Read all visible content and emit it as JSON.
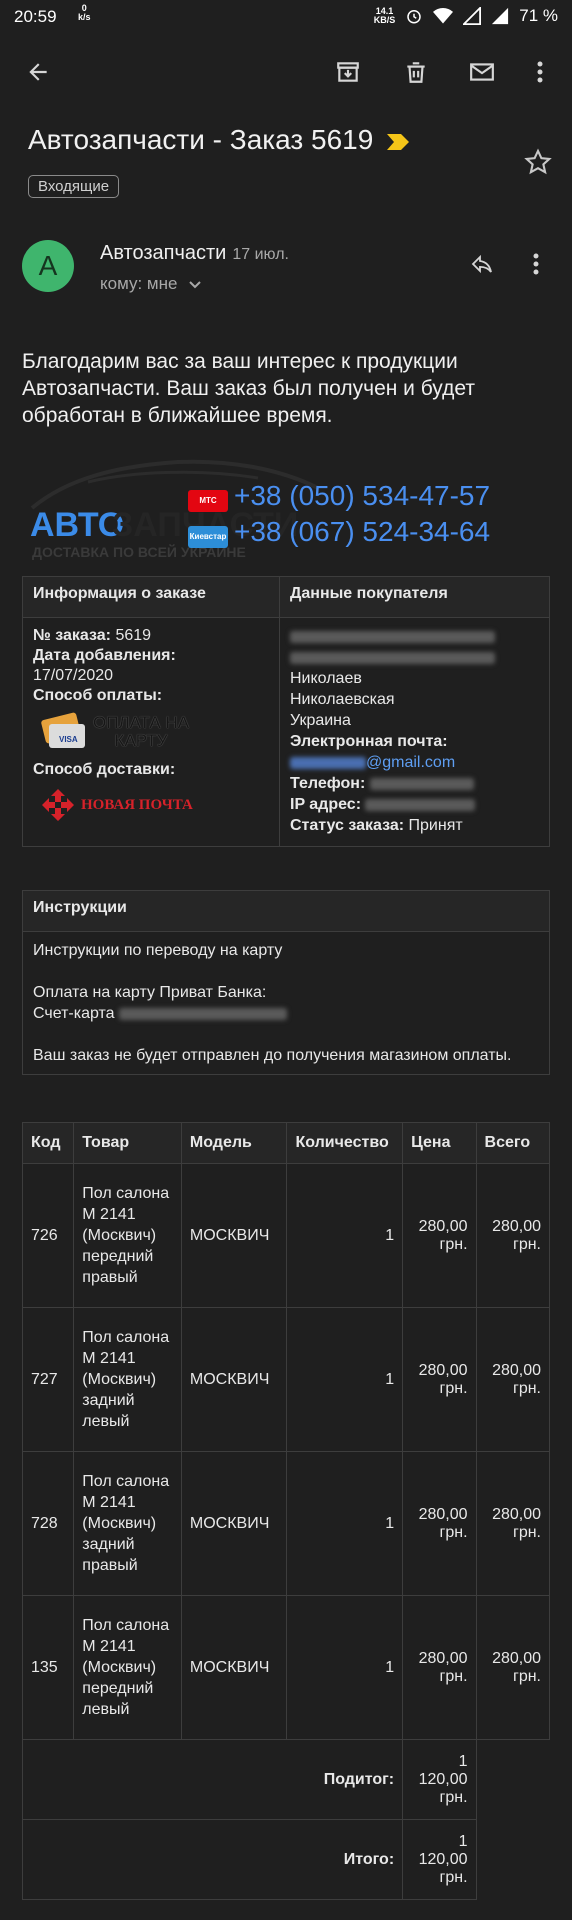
{
  "status": {
    "time": "20:59",
    "net_speed_left_top": "0",
    "net_speed_left_bottom": "k/s",
    "net_speed_right_top": "14.1",
    "net_speed_right_bottom": "KB/S",
    "battery": "71 %"
  },
  "email": {
    "subject": "Автозапчасти - Заказ 5619",
    "label_chip": "Входящие",
    "sender_name": "Автозапчасти",
    "date": "17 июл.",
    "to": "кому: мне",
    "avatar_letter": "A",
    "intro": "Благодарим вас за ваш интерес к продукции Автозапчасти. Ваш заказ был получен и будет обработан в ближайшее время."
  },
  "logo": {
    "brand_left": "АВТО",
    "brand_right": "ЗАПЧАСТИ",
    "tagline": "ДОСТАВКА ПО ВСЕЙ УКРАИНЕ",
    "phone1": "+38 (050) 534-47-57",
    "phone2": "+38 (067) 524-34-64",
    "op1": "МТС",
    "op2": "Киевстар"
  },
  "order_info": {
    "header_left": "Информация о заказе",
    "header_right": "Данные покупателя",
    "order_no_label": "№ заказа:",
    "order_no": "5619",
    "date_label": "Дата добавления:",
    "date": "17/07/2020",
    "payment_label": "Способ оплаты:",
    "payment_badge_line1": "ОПЛАТА НА",
    "payment_badge_line2": "КАРТУ",
    "payment_card_text": "VISA",
    "delivery_label": "Способ доставки:",
    "delivery_badge": "НОВАЯ ПОЧТА",
    "city": "Николаев",
    "region": "Николаевская",
    "country": "Украина",
    "email_label": "Электронная почта:",
    "email_domain": "@gmail.com",
    "phone_label": "Телефон:",
    "ip_label": "IP адрес:",
    "status_label": "Статус заказа:",
    "status": "Принят"
  },
  "instructions": {
    "header": "Инструкции",
    "line1": "Инструкции по переводу на карту",
    "line2": "Оплата на карту Приват Банка:",
    "line3": "Счет-карта",
    "line4": "Ваш заказ не будет отправлен до получения магазином оплаты."
  },
  "products": {
    "headers": [
      "Код",
      "Товар",
      "Модель",
      "Количество",
      "Цена",
      "Всего"
    ],
    "rows": [
      {
        "code": "726",
        "name": "Пол салона М 2141 (Москвич) передний правый",
        "model": "МОСКВИЧ",
        "qty": "1",
        "price": "280,00 грн.",
        "total": "280,00 грн."
      },
      {
        "code": "727",
        "name": "Пол салона М 2141 (Москвич) задний левый",
        "model": "МОСКВИЧ",
        "qty": "1",
        "price": "280,00 грн.",
        "total": "280,00 грн."
      },
      {
        "code": "728",
        "name": "Пол салона М 2141 (Москвич) задний правый",
        "model": "МОСКВИЧ",
        "qty": "1",
        "price": "280,00 грн.",
        "total": "280,00 грн."
      },
      {
        "code": "135",
        "name": "Пол салона М 2141 (Москвич) передний левый",
        "model": "МОСКВИЧ",
        "qty": "1",
        "price": "280,00 грн.",
        "total": "280,00 грн."
      }
    ],
    "subtotal_label": "Подитог:",
    "subtotal": "1 120,00 грн.",
    "total_label": "Итого:",
    "total": "1 120,00 грн."
  },
  "icons": {
    "back": "back-arrow-icon",
    "archive": "archive-icon",
    "delete": "trash-icon",
    "mail": "mail-icon",
    "more": "more-vert-icon",
    "star": "star-icon",
    "reply": "reply-icon",
    "important": "important-marker-icon"
  },
  "colors": {
    "background": "#1f1f1f",
    "avatar": "#3fb56d",
    "link": "#4a8ff0",
    "important": "#f5c518"
  }
}
